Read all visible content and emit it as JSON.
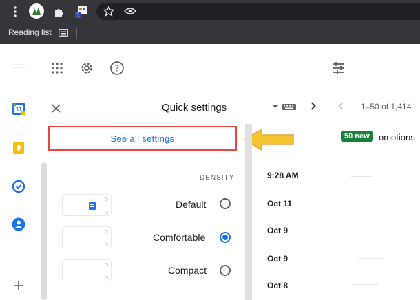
{
  "browser": {
    "bookmark_label": "Reading list"
  },
  "quick_settings": {
    "title": "Quick settings",
    "see_all": "See all settings",
    "density_label": "DENSITY",
    "options": [
      {
        "label": "Default",
        "checked": false
      },
      {
        "label": "Comfortable",
        "checked": true
      },
      {
        "label": "Compact",
        "checked": false
      }
    ]
  },
  "inbox": {
    "pagination": "1–50 of 1,414",
    "promotions_tab": "omotions",
    "new_badge": "50 new",
    "dates": [
      "9:28 AM",
      "Oct 11",
      "Oct 9",
      "Oct 9",
      "Oct 8"
    ]
  },
  "colors": {
    "accent": "#1a73e8",
    "highlight_box": "#e8473f",
    "arrow": "#f4c430",
    "badge": "#188038"
  }
}
